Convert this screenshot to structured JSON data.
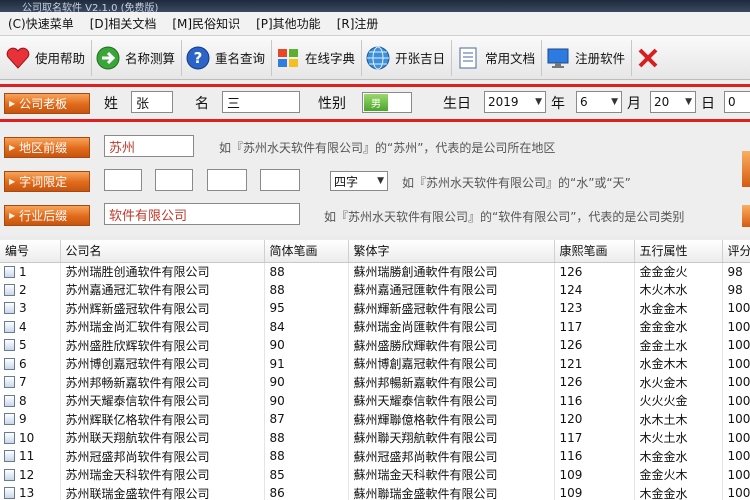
{
  "window": {
    "title": "公司取名软件 V2.1.0 (免费版)"
  },
  "menu": [
    "(C)快速菜单",
    "[D]相关文档",
    "[M]民俗知识",
    "[P]其他功能",
    "[R]注册"
  ],
  "toolbar": [
    {
      "label": "使用帮助",
      "icon": "heart-icon"
    },
    {
      "label": "名称测算",
      "icon": "forward-arrow-icon"
    },
    {
      "label": "重名查询",
      "icon": "question-icon"
    },
    {
      "label": "在线字典",
      "icon": "windows-logo-icon"
    },
    {
      "label": "开张吉日",
      "icon": "globe-icon"
    },
    {
      "label": "常用文档",
      "icon": "document-icon"
    },
    {
      "label": "注册软件",
      "icon": "monitor-icon"
    },
    {
      "label": "",
      "icon": "close-icon"
    }
  ],
  "form": {
    "owner_btn": "公司老板",
    "surname_label": "姓",
    "surname_value": "张",
    "given_label": "名",
    "given_value": "三",
    "gender_label": "性别",
    "gender_toggle": "男",
    "birthday_label": "生日",
    "year": "2019",
    "year_unit": "年",
    "month": "6",
    "month_unit": "月",
    "day": "20",
    "day_unit": "日",
    "hour": "0",
    "region_btn": "地区前缀",
    "region_value": "苏州",
    "region_hint": "如『苏州水天软件有限公司』的“苏州”，代表的是公司所在地区",
    "word_btn": "字词限定",
    "word_count": "四字",
    "word_hint": "如『苏州水天软件有限公司』的“水”或“天”",
    "industry_btn": "行业后缀",
    "industry_value": "软件有限公司",
    "industry_hint": "如『苏州水天软件有限公司』的“软件有限公司”，代表的是公司类别"
  },
  "table": {
    "columns": [
      "编号",
      "公司名",
      "简体笔画",
      "繁体字",
      "康熙笔画",
      "五行属性",
      "评分"
    ],
    "rows": [
      [
        "1",
        "苏州瑞胜创通软件有限公司",
        "88",
        "蘇州瑞勝創通軟件有限公司",
        "126",
        "金金金火",
        "98"
      ],
      [
        "2",
        "苏州嘉通冠汇软件有限公司",
        "88",
        "蘇州嘉通冠匯軟件有限公司",
        "124",
        "木火木水",
        "98"
      ],
      [
        "3",
        "苏州辉新盛冠软件有限公司",
        "95",
        "蘇州輝新盛冠軟件有限公司",
        "123",
        "水金金木",
        "100"
      ],
      [
        "4",
        "苏州瑞金尚汇软件有限公司",
        "84",
        "蘇州瑞金尚匯軟件有限公司",
        "117",
        "金金金水",
        "100"
      ],
      [
        "5",
        "苏州盛胜欣辉软件有限公司",
        "90",
        "蘇州盛勝欣輝軟件有限公司",
        "126",
        "金金土水",
        "100"
      ],
      [
        "6",
        "苏州博创嘉冠软件有限公司",
        "91",
        "蘇州博創嘉冠軟件有限公司",
        "121",
        "水金木木",
        "100"
      ],
      [
        "7",
        "苏州邦畅新嘉软件有限公司",
        "90",
        "蘇州邦暢新嘉軟件有限公司",
        "126",
        "水火金木",
        "100"
      ],
      [
        "8",
        "苏州天耀泰信软件有限公司",
        "90",
        "蘇州天耀泰信軟件有限公司",
        "116",
        "火火火金",
        "100"
      ],
      [
        "9",
        "苏州辉联亿格软件有限公司",
        "87",
        "蘇州輝聯億格軟件有限公司",
        "120",
        "水木土木",
        "100"
      ],
      [
        "10",
        "苏州联天翔航软件有限公司",
        "88",
        "蘇州聯天翔航軟件有限公司",
        "117",
        "木火土水",
        "100"
      ],
      [
        "11",
        "苏州冠盛邦尚软件有限公司",
        "88",
        "蘇州冠盛邦尚軟件有限公司",
        "116",
        "木金金水",
        "100"
      ],
      [
        "12",
        "苏州瑞金天科软件有限公司",
        "85",
        "蘇州瑞金天科軟件有限公司",
        "109",
        "金金火木",
        "100"
      ],
      [
        "13",
        "苏州联瑞金盛软件有限公司",
        "86",
        "蘇州聯瑞金盛軟件有限公司",
        "109",
        "木金金水",
        "100"
      ]
    ]
  },
  "colors": {
    "accent_orange": "#e06a1a",
    "red_rule": "#e02020",
    "toggle_green": "#4aa52a"
  }
}
